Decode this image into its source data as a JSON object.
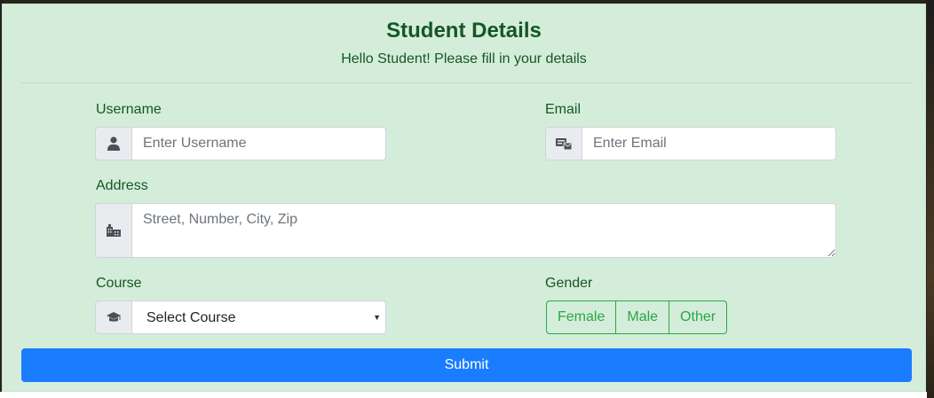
{
  "header": {
    "title": "Student Details",
    "subtitle": "Hello Student! Please fill in your details"
  },
  "form": {
    "username": {
      "label": "Username",
      "placeholder": "Enter Username",
      "icon": "user-icon"
    },
    "email": {
      "label": "Email",
      "placeholder": "Enter Email",
      "icon": "mail-icon"
    },
    "address": {
      "label": "Address",
      "placeholder": "Street, Number, City, Zip",
      "icon": "building-icon"
    },
    "course": {
      "label": "Course",
      "selected": "Select Course",
      "icon": "graduation-cap-icon"
    },
    "gender": {
      "label": "Gender",
      "options": [
        "Female",
        "Male",
        "Other"
      ]
    },
    "submit_label": "Submit"
  },
  "colors": {
    "card_bg": "#d4edda",
    "text_green": "#155724",
    "outline_green": "#28a745",
    "primary": "#1a7cff"
  }
}
